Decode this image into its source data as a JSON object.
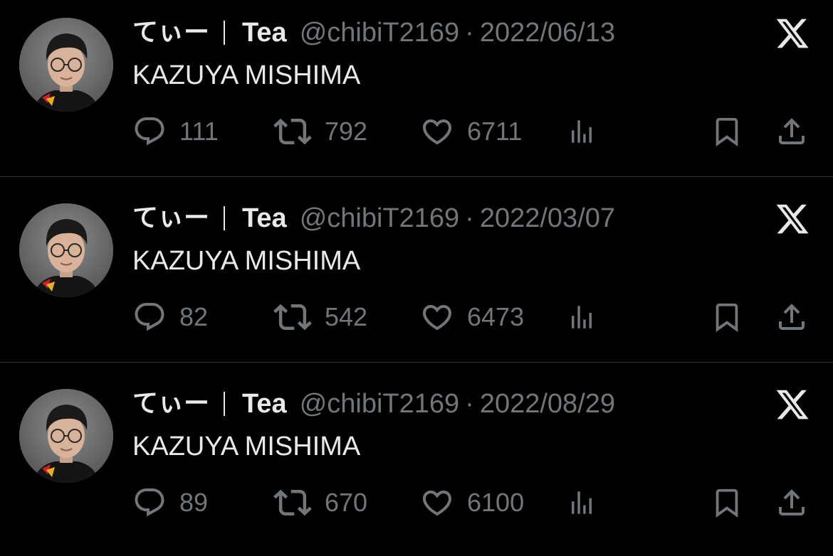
{
  "colors": {
    "background": "#000000",
    "primary_text": "#e7e9ea",
    "secondary_text": "#71767b",
    "divider": "#2f3336"
  },
  "tweets": [
    {
      "display_name": "てぃー",
      "display_name_2": "Tea",
      "handle": "@chibiT2169",
      "separator": "·",
      "date": "2022/06/13",
      "text": "KAZUYA MISHIMA",
      "replies": "111",
      "retweets": "792",
      "likes": "6711",
      "icons": [
        "reply-icon",
        "retweet-icon",
        "like-icon",
        "views-icon",
        "bookmark-icon",
        "share-icon",
        "x-logo-icon"
      ]
    },
    {
      "display_name": "てぃー",
      "display_name_2": "Tea",
      "handle": "@chibiT2169",
      "separator": "·",
      "date": "2022/03/07",
      "text": "KAZUYA MISHIMA",
      "replies": "82",
      "retweets": "542",
      "likes": "6473",
      "icons": [
        "reply-icon",
        "retweet-icon",
        "like-icon",
        "views-icon",
        "bookmark-icon",
        "share-icon",
        "x-logo-icon"
      ]
    },
    {
      "display_name": "てぃー",
      "display_name_2": "Tea",
      "handle": "@chibiT2169",
      "separator": "·",
      "date": "2022/08/29",
      "text": "KAZUYA MISHIMA",
      "replies": "89",
      "retweets": "670",
      "likes": "6100",
      "icons": [
        "reply-icon",
        "retweet-icon",
        "like-icon",
        "views-icon",
        "bookmark-icon",
        "share-icon",
        "x-logo-icon"
      ]
    }
  ]
}
